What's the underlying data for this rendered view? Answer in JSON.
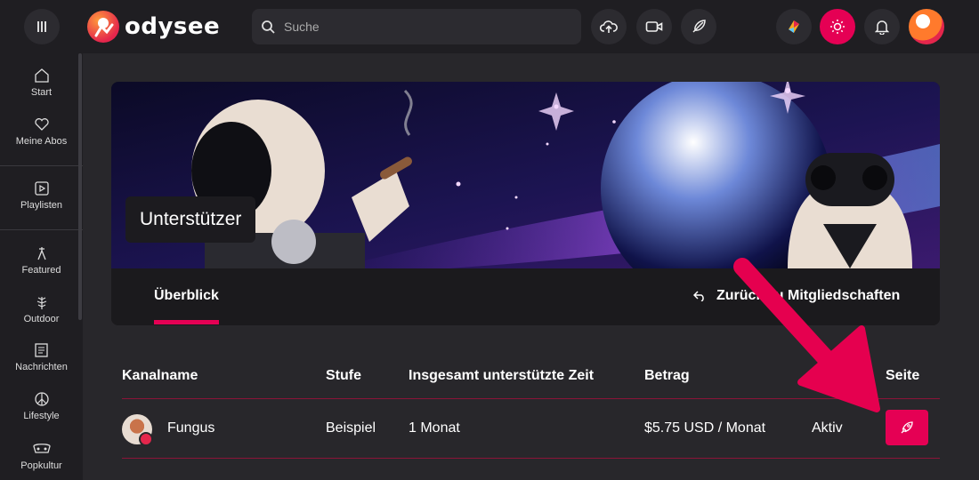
{
  "header": {
    "logo_text": "odysee",
    "search_placeholder": "Suche"
  },
  "sidebar": {
    "items": [
      {
        "label": "Start",
        "icon": "home-icon"
      },
      {
        "label": "Meine Abos",
        "icon": "heart-icon"
      },
      {
        "label": "Playlisten",
        "icon": "playlist-icon"
      },
      {
        "label": "Featured",
        "icon": "featured-icon"
      },
      {
        "label": "Outdoor",
        "icon": "outdoor-icon"
      },
      {
        "label": "Nachrichten",
        "icon": "news-icon"
      },
      {
        "label": "Lifestyle",
        "icon": "lifestyle-icon"
      },
      {
        "label": "Popkultur",
        "icon": "popculture-icon"
      }
    ]
  },
  "page": {
    "title": "Unterstützer",
    "tab_overview": "Überblick",
    "back_link": "Zurück zu Mitgliedschaften"
  },
  "table": {
    "headers": [
      "Kanalname",
      "Stufe",
      "Insgesamt unterstützte Zeit",
      "Betrag",
      "Status",
      "Seite"
    ],
    "rows": [
      {
        "channel": "Fungus",
        "tier": "Beispiel",
        "time": "1 Monat",
        "amount": "$5.75 USD / Monat",
        "status": "Aktiv"
      }
    ]
  },
  "colors": {
    "accent": "#e50054",
    "background": "#28272b",
    "header": "#1f1e22"
  }
}
